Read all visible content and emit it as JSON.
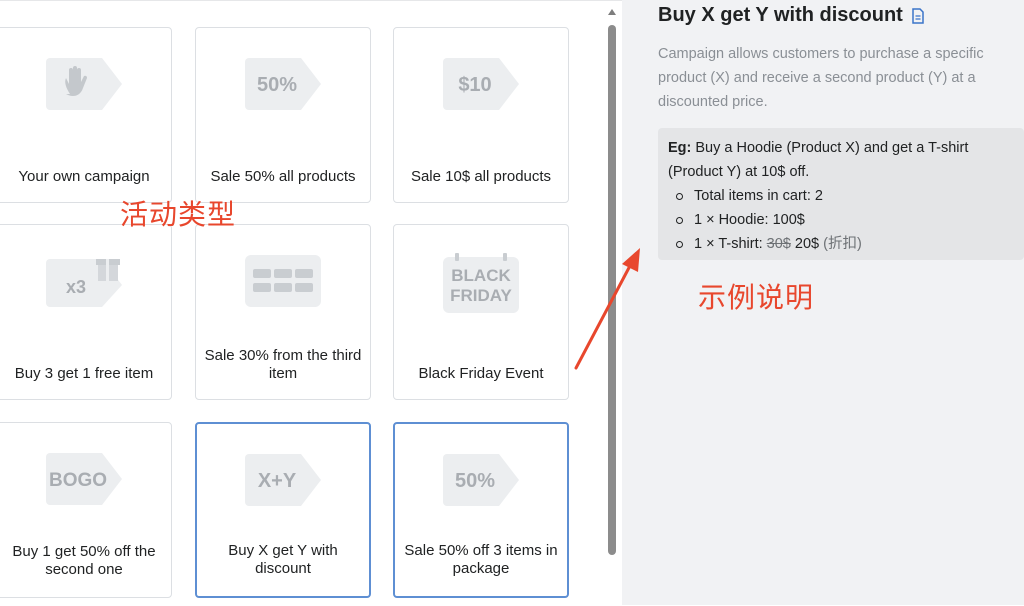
{
  "cards": [
    {
      "tag": "hand-wave-icon",
      "tag_text": "",
      "label": "Your own campaign",
      "selected": false
    },
    {
      "tag": "percent-tag-icon",
      "tag_text": "50%",
      "label": "Sale 50% all products",
      "selected": false
    },
    {
      "tag": "money-tag-icon",
      "tag_text": "$10",
      "label": "Sale 10$ all products",
      "selected": false
    },
    {
      "tag": "gift-icon",
      "tag_text": "x3",
      "label": "Buy 3 get 1 free item",
      "selected": false
    },
    {
      "tag": "grid-icon",
      "tag_text": "",
      "label": "Sale 30% from the third item",
      "selected": false
    },
    {
      "tag": "calendar-icon",
      "tag_text": "BLACK FRIDAY",
      "label": "Black Friday Event",
      "selected": false
    },
    {
      "tag": "bogo-tag-icon",
      "tag_text": "BOGO",
      "label": "Buy 1 get 50% off the second one",
      "selected": false
    },
    {
      "tag": "xy-tag-icon",
      "tag_text": "X+Y",
      "label": "Buy X get Y with discount",
      "selected": true
    },
    {
      "tag": "percent-tag-icon",
      "tag_text": "50%",
      "label": "Sale 50% off 3 items in package",
      "selected": true
    }
  ],
  "annotations": {
    "campaign_types": "活动类型",
    "example_note": "示例说明"
  },
  "detail": {
    "title": "Buy X get Y with discount",
    "description": "Campaign allows customers to purchase a specific product (X) and receive a second product (Y) at a discounted price.",
    "example": {
      "prefix": "Eg:",
      "intro": " Buy a Hoodie (Product X) and get a T-shirt (Product Y) at 10$ off.",
      "item1": "Total items in cart: 2",
      "item2": "1 × Hoodie: 100$",
      "item3_prefix": "1 × T-shirt: ",
      "item3_old": "30$",
      "item3_new": " 20$",
      "item3_note": " (折扣)"
    }
  },
  "colors": {
    "accent_border": "#5e8fd3",
    "annotation_red": "#e8472d",
    "tag_gray": "#eceef0",
    "tag_text": "#a9adb2"
  }
}
